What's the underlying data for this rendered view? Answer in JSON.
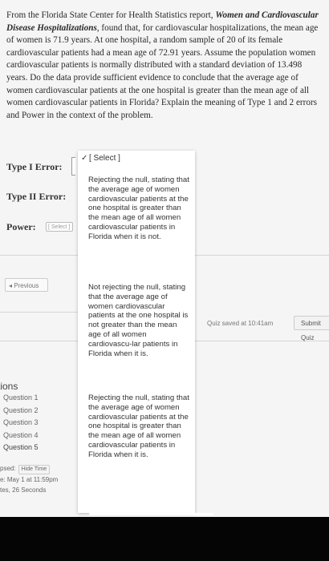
{
  "question": {
    "p1": "From the Florida State Center for Health Statistics report, ",
    "report_title": "Women and Cardiovascular Disease Hospitalizations",
    "p2": ", found that, for cardiovascular hospitalizations, the mean age of women is 71.9 years. At one hospital, a random sample of 20 of its female cardiovascular patients had a mean age of 72.91 years. Assume the population women cardiovascular patients is normally distributed with a standard deviation of 13.498 years. Do the data provide sufficient evidence to conclude that the average age of women cardiovascular patients at the one hospital is greater than the mean age of all women cardiovascular patients in Florida? Explain the meaning of Type 1 and 2 errors and Power in the context of the problem."
  },
  "labels": {
    "type1": "Type I Error:",
    "type2": "Type II Error:",
    "power": "Power:"
  },
  "power_select_placeholder": "[ Select ]",
  "dropdown": {
    "selected": "[ Select ]",
    "options": [
      "Rejecting the null, stating that the average age of women cardiovascular patients at the one hospital is greater than the mean age of all women cardiovascular patients in Florida when it is not.",
      "Not rejecting the null, stating that the average age of women cardiovascular patients at the one hospital is not greater than the mean age of all women cardiovascu-lar patients in Florida when it is.",
      "Rejecting the null, stating that the average age of women cardiovascular patients at the one hospital is greater than the mean age of all women cardiovascular patients in Florida when it is."
    ]
  },
  "nav": {
    "previous": "◂ Previous",
    "quiz_saved": "Quiz saved at 10:41am",
    "submit": "Submit Quiz"
  },
  "sidebar": {
    "heading": "tions",
    "questions": [
      "Question 1",
      "Question 2",
      "Question 3",
      "Question 4",
      "Question 5"
    ]
  },
  "timer": {
    "elapsed_label": "psed:",
    "hide_button": "Hide Time",
    "due": "e: May 1 at 11:59pm",
    "time": "tes, 26 Seconds"
  }
}
